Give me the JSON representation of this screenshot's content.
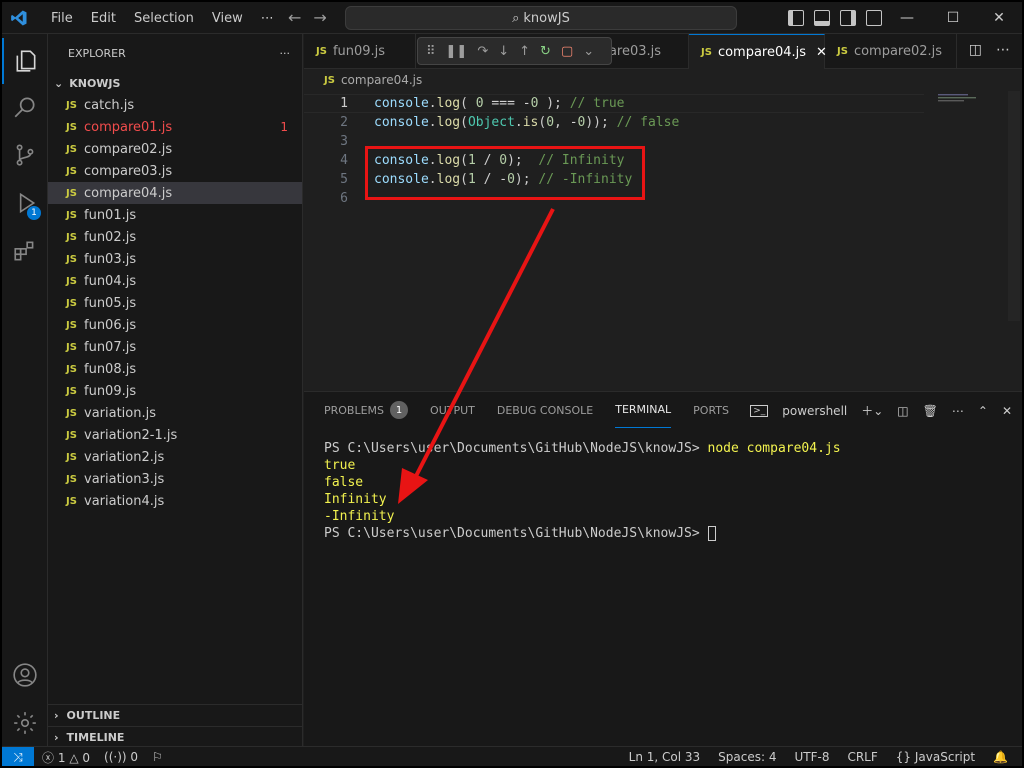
{
  "titlebar": {
    "menu": [
      "File",
      "Edit",
      "Selection",
      "View",
      "⋯"
    ],
    "search": "knowJS"
  },
  "activity": {
    "debug_badge": "1"
  },
  "explorer": {
    "header": "EXPLORER",
    "more": "···",
    "folder": "KNOWJS",
    "files": [
      {
        "name": "catch.js"
      },
      {
        "name": "compare01.js",
        "count": "1"
      },
      {
        "name": "compare02.js"
      },
      {
        "name": "compare03.js"
      },
      {
        "name": "compare04.js"
      },
      {
        "name": "fun01.js"
      },
      {
        "name": "fun02.js"
      },
      {
        "name": "fun03.js"
      },
      {
        "name": "fun04.js"
      },
      {
        "name": "fun05.js"
      },
      {
        "name": "fun06.js"
      },
      {
        "name": "fun07.js"
      },
      {
        "name": "fun08.js"
      },
      {
        "name": "fun09.js"
      },
      {
        "name": "variation.js"
      },
      {
        "name": "variation2-1.js"
      },
      {
        "name": "variation2.js"
      },
      {
        "name": "variation3.js"
      },
      {
        "name": "variation4.js"
      }
    ],
    "outline": "OUTLINE",
    "timeline": "TIMELINE",
    "js_label": "JS"
  },
  "tabs": [
    {
      "label": "fun09.js"
    },
    {
      "label": "compare03.js"
    },
    {
      "label": "compare04.js",
      "close": "✕"
    },
    {
      "label": "compare02.js"
    }
  ],
  "breadcrumb": "compare04.js",
  "editor": {
    "line_numbers": [
      "1",
      "2",
      "3",
      "4",
      "5",
      "6"
    ]
  },
  "panel": {
    "tabs": [
      "PROBLEMS",
      "OUTPUT",
      "DEBUG CONSOLE",
      "TERMINAL",
      "PORTS"
    ],
    "problems_count": "1",
    "shell": "powershell",
    "terminal": {
      "prompt1": "PS C:\\Users\\user\\Documents\\GitHub\\NodeJS\\knowJS> ",
      "command": "node compare04.js",
      "outputs": [
        "true",
        "false",
        "Infinity",
        "-Infinity"
      ],
      "prompt2": "PS C:\\Users\\user\\Documents\\GitHub\\NodeJS\\knowJS> "
    }
  },
  "statusbar": {
    "errors": "1",
    "warnings": "0",
    "ports": "0",
    "position": "Ln 1, Col 33",
    "spaces": "Spaces: 4",
    "encoding": "UTF-8",
    "eol": "CRLF",
    "language": "JavaScript",
    "lang_braces": "{}"
  },
  "colors": {
    "accent": "#0078d4",
    "annotation": "#e81414",
    "terminal_output": "#f2f24f",
    "error": "#f14c4c"
  }
}
